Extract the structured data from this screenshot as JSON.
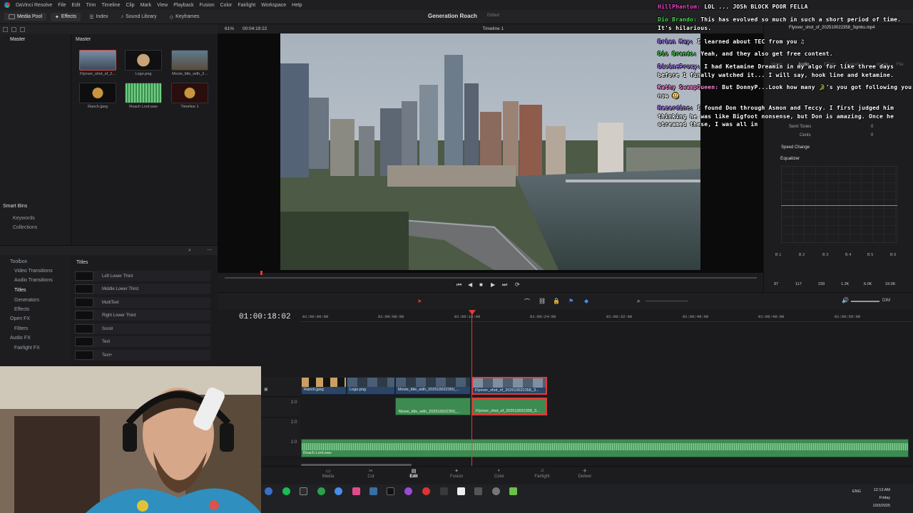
{
  "menu": {
    "app_name": "DaVinci Resolve",
    "items": [
      "File",
      "Edit",
      "Trim",
      "Timeline",
      "Clip",
      "Mark",
      "View",
      "Playback",
      "Fusion",
      "Color",
      "Fairlight",
      "Workspace",
      "Help"
    ]
  },
  "toolbar": {
    "media_pool": "Media Pool",
    "effects": "Effects",
    "index": "Index",
    "sound_library": "Sound Library",
    "keyframes": "Keyframes",
    "project_title": "Generation Roach",
    "project_status": "Edited"
  },
  "media_pool": {
    "bin_title": "Master",
    "grid_title": "Master",
    "clips": [
      {
        "name": "Flyover_shot_of_2...",
        "color": "#3c4a5a"
      },
      {
        "name": "Logo.png",
        "color": "#101012"
      },
      {
        "name": "Movie_title_with_2...",
        "color": "#5b4b3a"
      },
      {
        "name": "Ranch.jpeg",
        "color": "#0e0e0e"
      },
      {
        "name": "Roach Lord.wav",
        "color": "#3e8b52"
      },
      {
        "name": "Timeline 1",
        "color": "#2a0d0d"
      }
    ],
    "smart_bins": "Smart Bins",
    "keywords": "Keywords",
    "collections": "Collections"
  },
  "effects": {
    "tree": [
      "Toolbox",
      "Video Transitions",
      "Audio Transitions",
      "Titles",
      "Generators",
      "Effects",
      "Open FX",
      "Filters",
      "Audio FX",
      "Fairlight FX"
    ],
    "selected_category": "Titles",
    "titles_header": "Titles",
    "titles": [
      "Left Lower Third",
      "Middle Lower Third",
      "MultiText",
      "Right Lower Third",
      "Scroll",
      "Text",
      "Text+"
    ]
  },
  "viewer": {
    "zoom": "61%",
    "timecode": "00:04:19:22",
    "timeline_name": "Timeline 1",
    "clip_name": "Flyover_shot_of_202510022358_3qmks.mp4"
  },
  "inspector": {
    "tabs": [
      "Video",
      "Audio",
      "Effect",
      "Transition",
      "Image",
      "File"
    ],
    "semi_tones": "Semi Tones",
    "cents": "Cents",
    "semi_val": "0",
    "cents_val": "0",
    "speed_change": "Speed Change",
    "equalizer": "Equalizer",
    "bands": [
      "B 1",
      "B 2",
      "B 3",
      "B 4",
      "B 5",
      "B 6"
    ],
    "band_values": [
      "97",
      "117",
      "239",
      "1.2K",
      "6.0K",
      "19.0K"
    ]
  },
  "chat": [
    {
      "user": "HillPhantom:",
      "color": "#f04ad0",
      "text": " LOL ... JOSh BLOCK POOR FELLA"
    },
    {
      "user": "Dio Brando:",
      "color": "#52e05a",
      "text": " This has evolved so much in such a short period of time. It's hilarious."
    },
    {
      "user": "Brian May:",
      "color": "#b083ff",
      "text": " I learned about TEC from you ♫"
    },
    {
      "user": "Dio Brando:",
      "color": "#52e05a",
      "text": " Yeah, and they also get free content."
    },
    {
      "user": "DivineProxy:",
      "color": "#b083ff",
      "text": " I had Ketamine Dreamin in my algo for like three days before I finally watched it... I will say, hook line and ketamine."
    },
    {
      "user": "Kathy SwampQueen:",
      "color": "#ff8ad8",
      "text": " But DonnyP...Look how many 🐊's you got following you now 😃"
    },
    {
      "user": "Hazardine:",
      "color": "#b083ff",
      "text": " I found Don through Asmon and Teccy. I first judged him thinking he was like Bigfoot nonsense, but Don is amazing. Once he streamed these, I was all in"
    }
  ],
  "timeline": {
    "timecode": "01:00:18:02",
    "ruler": [
      "01:00:00:00",
      "01:00:08:00",
      "01:00:16:00",
      "01:00:24:00",
      "01:00:32:00",
      "01:00:40:00",
      "01:00:48:00",
      "01:00:56:00"
    ],
    "video_clips": [
      "Ranch.jpeg",
      "Logo.png",
      "Movie_title_with_202510022350_...",
      "Flyover_shot_of_202510022358_3..."
    ],
    "audio_clips": [
      "Movie_title_with_202510022350_...",
      "Flyover_shot_of_202510022358_3..."
    ],
    "music_clip": "Roach Lord.wav",
    "track_levels": [
      "2.0",
      "2.0",
      "2.0"
    ],
    "volume_label": "DIM"
  },
  "pages": [
    "Media",
    "Cut",
    "Edit",
    "Fusion",
    "Color",
    "Fairlight",
    "Deliver"
  ],
  "active_page": "Edit",
  "clock": {
    "time": "12:13 AM",
    "day": "Friday",
    "date": "10/3/2025",
    "lang": "ENG"
  }
}
